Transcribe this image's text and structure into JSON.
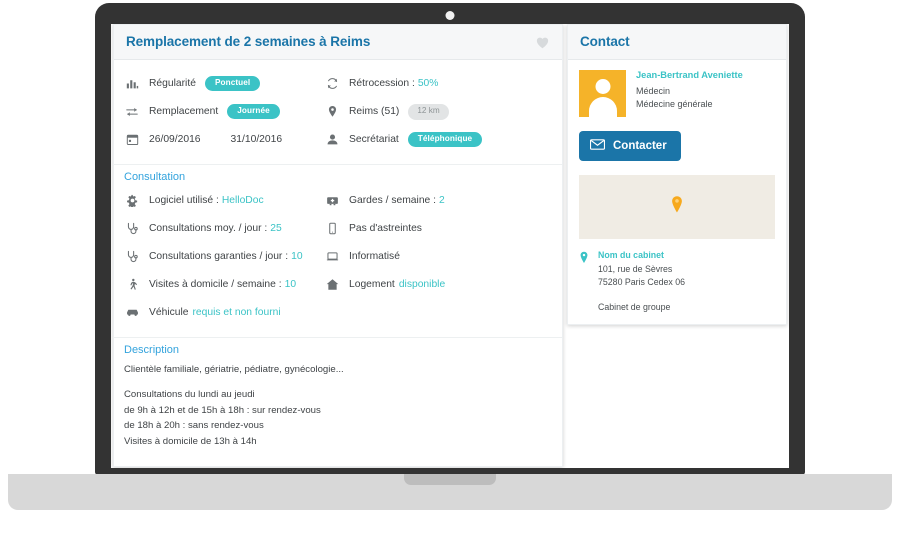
{
  "device": {
    "type": "laptop-mockup"
  },
  "offer": {
    "header": {
      "title": "Remplacement de 2 semaines à Reims",
      "favorite_icon": "heart-icon"
    },
    "details": [
      {
        "icon": "bar-chart-icon",
        "label": "Régularité",
        "badge": "Ponctuel",
        "badge_style": "teal"
      },
      {
        "icon": "retrocession-icon",
        "label": "Rétrocession :",
        "value": "50%",
        "value_style": "teal"
      },
      {
        "icon": "exchange-icon",
        "label": "Remplacement",
        "badge": "Journée",
        "badge_style": "teal"
      },
      {
        "icon": "map-pin-icon",
        "label": "Reims (51)",
        "badge": "12 km",
        "badge_style": "gray"
      },
      {
        "icon": "calendar-icon",
        "date_start": "26/09/2016",
        "date_end": "31/10/2016"
      },
      {
        "icon": "user-icon",
        "label": "Secrétariat",
        "badge": "Téléphonique",
        "badge_style": "teal"
      }
    ],
    "consultation": {
      "heading": "Consultation",
      "left": [
        {
          "icon": "gear-icon",
          "label": "Logiciel utilisé :",
          "value": "HelloDoc",
          "value_style": "teal"
        },
        {
          "icon": "stethoscope-icon",
          "label": "Consultations moy. / jour :",
          "value": "25",
          "value_style": "teal"
        },
        {
          "icon": "stethoscope-icon",
          "label": "Consultations garanties / jour :",
          "value": "10",
          "value_style": "teal"
        },
        {
          "icon": "walking-icon",
          "label": "Visites à domicile / semaine :",
          "value": "10",
          "value_style": "teal"
        },
        {
          "icon": "car-icon",
          "label": "Véhicule",
          "value": "requis et non fourni",
          "value_style": "teal"
        }
      ],
      "right": [
        {
          "icon": "ambulance-icon",
          "label": "Gardes / semaine :",
          "value": "2",
          "value_style": "teal"
        },
        {
          "icon": "mobile-icon",
          "label": "Pas d'astreintes",
          "value": "",
          "value_style": "none"
        },
        {
          "icon": "laptop-icon",
          "label": "Informatisé",
          "value": "",
          "value_style": "none"
        },
        {
          "icon": "home-icon",
          "label": "Logement",
          "value": "disponible",
          "value_style": "teal"
        }
      ]
    },
    "description": {
      "heading": "Description",
      "paragraph_1": "Clientèle familiale, gériatrie, pédiatre, gynécologie...",
      "paragraph_2_lines": [
        "Consultations du lundi au jeudi",
        "de 9h à 12h et de 15h à 18h : sur rendez-vous",
        "de 18h à 20h : sans rendez-vous",
        "Visites à domicile de 13h à 14h"
      ]
    }
  },
  "contact": {
    "heading": "Contact",
    "person": {
      "name": "Jean-Bertrand Aveniette",
      "role_line_1": "Médecin",
      "role_line_2": "Médecine générale",
      "avatar_icon": "user-avatar-icon"
    },
    "button": {
      "label": "Contacter",
      "icon": "envelope-icon"
    },
    "map": {
      "pin_icon": "map-marker-icon"
    },
    "cabinet": {
      "pin_icon": "map-pin-icon",
      "name": "Nom du cabinet",
      "address_line_1": "101, rue de Sèvres",
      "address_line_2": "75280 Paris Cedex 06",
      "type": "Cabinet de groupe"
    }
  },
  "colors": {
    "teal": "#3bc3c6",
    "blue_title": "#1b75a8",
    "blue_section": "#33a3dd",
    "button_blue": "#1b75a8",
    "avatar_orange": "#f5b329",
    "map_bg": "#f0ece4",
    "bezel": "#333333",
    "base": "#d8d8d8"
  }
}
